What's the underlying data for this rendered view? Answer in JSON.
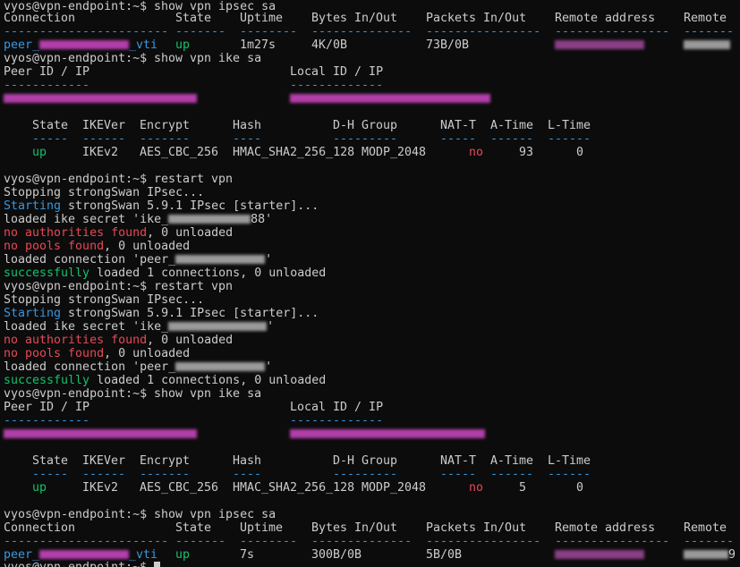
{
  "terminal": {
    "prompt": "vyos@vpn-endpoint:~$ ",
    "colors": {
      "background": "#0c0c0c",
      "text": "#cccccc",
      "cyan": "#3a96dd",
      "green": "#13c26b",
      "red": "#e74856"
    },
    "cmd_show_ipsec": "show vpn ipsec sa",
    "cmd_show_ike": "show vpn ike sa",
    "cmd_restart": "restart vpn",
    "ipsec_headers": [
      "Connection",
      "State",
      "Uptime",
      "Bytes In/Out",
      "Packets In/Out",
      "Remote address",
      "Remote"
    ],
    "ipsec_dashes": [
      "-----------------------",
      "-------",
      "--------",
      "--------------",
      "----------------",
      "----------------",
      "-------"
    ],
    "ipsec_row1": {
      "conn_prefix": "peer_",
      "conn_suffix": "_vti",
      "state": "up",
      "uptime": "1m27s",
      "bytes": "4K/0B",
      "packets": "73B/0B"
    },
    "ipsec_row2": {
      "conn_prefix": "peer_",
      "conn_suffix": "_vti",
      "state": "up",
      "uptime": "7s",
      "bytes": "300B/0B",
      "packets": "5B/0B",
      "remote_end": "9"
    },
    "ike_peer_header": "Peer ID / IP",
    "ike_local_header": "Local ID / IP",
    "ike_peer_dashes": "------------",
    "ike_local_dashes": "-------------",
    "ike_headers": [
      "State",
      "IKEVer",
      "Encrypt",
      "Hash",
      "D-H Group",
      "NAT-T",
      "A-Time",
      "L-Time"
    ],
    "ike_dashes": [
      "-----",
      "------",
      "-------",
      "----",
      "---------",
      "-----",
      "------",
      "------"
    ],
    "ike_row1": {
      "state": "up",
      "ikever": "IKEv2",
      "encrypt": "AES_CBC_256",
      "hash": "HMAC_SHA2_256_128",
      "dh": "MODP_2048",
      "natt": "no",
      "atime": "93",
      "ltime": "0"
    },
    "ike_row2": {
      "state": "up",
      "ikever": "IKEv2",
      "encrypt": "AES_CBC_256",
      "hash": "HMAC_SHA2_256_128",
      "dh": "MODP_2048",
      "natt": "no",
      "atime": "5",
      "ltime": "0"
    },
    "restart": {
      "stopping": "Stopping strongSwan IPsec...",
      "starting_word": "Starting",
      "starting_rest": " strongSwan 5.9.1 IPsec [starter]...",
      "secret_prefix": "loaded ike secret '",
      "secret1_visible": "ike_",
      "secret1_tail": "88'",
      "secret2_visible": "ike_",
      "secret_tail": "'",
      "no_auth": "no authorities found",
      "zero_unloaded": ", 0 unloaded",
      "no_pools": "no pools found",
      "conn_prefix": "loaded connection 'peer_",
      "conn_tail": "'",
      "success": "successfully",
      "success_rest": " loaded 1 connections, 0 unloaded"
    }
  }
}
